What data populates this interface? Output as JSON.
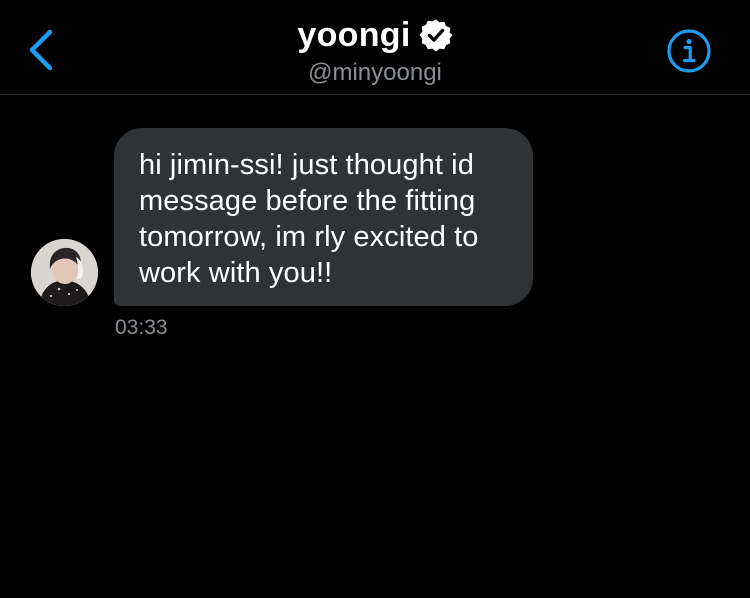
{
  "header": {
    "back_icon": "chevron-left-icon",
    "name": "yoongi",
    "verified_icon": "verified-badge-icon",
    "handle": "@minyoongi",
    "info_icon": "info-circle-icon",
    "accent_color": "#1d9bf0"
  },
  "conversation": {
    "messages": [
      {
        "lines": [
          "hi jimin-ssi! just thought id",
          "message before the fitting",
          "tomorrow, im rly excited to",
          "work with you!!"
        ],
        "time": "03:33"
      }
    ]
  },
  "colors": {
    "background": "#000000",
    "bubble": "#2f3336",
    "secondary_text": "#8b8f94",
    "divider": "#2f3336"
  }
}
